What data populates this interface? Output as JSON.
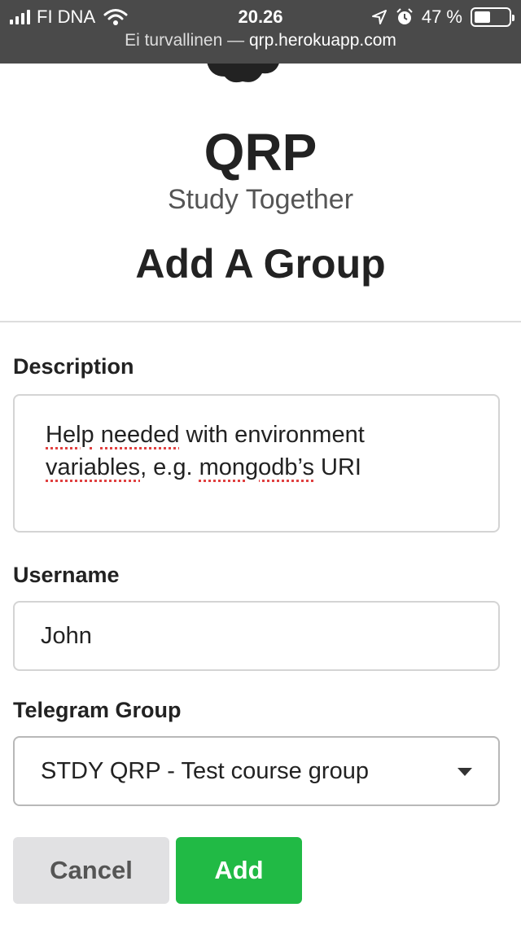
{
  "status_bar": {
    "carrier": "FI DNA",
    "time": "20.26",
    "battery_percent": "47 %",
    "battery_level": 0.47,
    "icons": [
      "signal-icon",
      "wifi-icon",
      "location-arrow-icon",
      "alarm-icon",
      "battery-icon"
    ]
  },
  "browser": {
    "security_text": "Ei turvallinen — ",
    "domain": "qrp.herokuapp.com"
  },
  "header": {
    "app_title": "QRP",
    "tagline": "Study Together",
    "page_heading": "Add A Group"
  },
  "form": {
    "description": {
      "label": "Description",
      "value_parts": [
        "Help",
        " ",
        "needed",
        " with environment ",
        "variables",
        ", e.g. ",
        "mongodb’s",
        " URI"
      ]
    },
    "username": {
      "label": "Username",
      "value": "John"
    },
    "telegram_group": {
      "label": "Telegram Group",
      "selected": "STDY QRP - Test course group"
    }
  },
  "actions": {
    "cancel_label": "Cancel",
    "add_label": "Add"
  },
  "colors": {
    "add_button": "#21ba45",
    "cancel_button": "#e1e1e3",
    "status_bar": "#4a4a4a",
    "spellcheck_underline": "#e04040"
  }
}
